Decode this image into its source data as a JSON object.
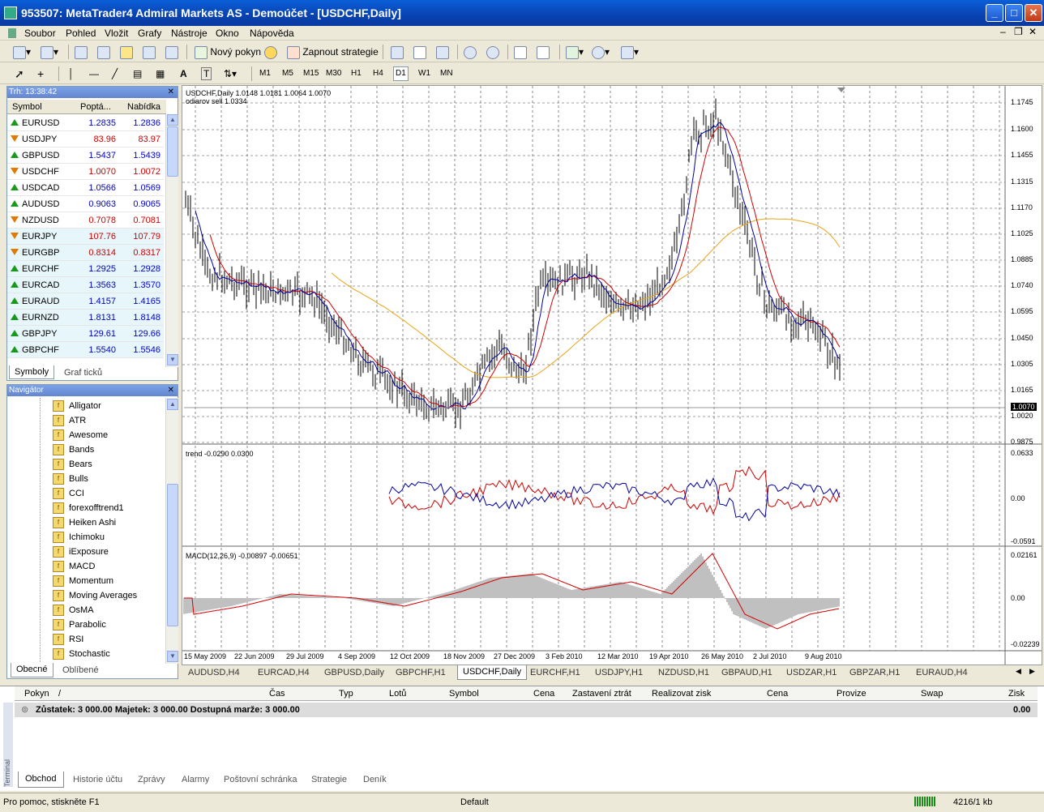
{
  "window": {
    "title": "953507: MetaTrader4 Admiral Markets AS - Demoúčet - [USDCHF,Daily]"
  },
  "menu": [
    "Soubor",
    "Pohled",
    "Vložit",
    "Grafy",
    "Nástroje",
    "Okno",
    "Nápověda"
  ],
  "toolbar": {
    "new_order": "Nový pokyn",
    "start_strategy": "Zapnout strategie"
  },
  "timeframes": [
    "M1",
    "M5",
    "M15",
    "M30",
    "H1",
    "H4",
    "D1",
    "W1",
    "MN"
  ],
  "market_watch": {
    "header": "Trh: 13:38:42",
    "columns": [
      "Symbol",
      "Poptá...",
      "Nabídka"
    ],
    "rows": [
      {
        "symbol": "EURUSD",
        "bid": "1.2835",
        "ask": "1.2836",
        "dir": "up",
        "color": "blue"
      },
      {
        "symbol": "USDJPY",
        "bid": "83.96",
        "ask": "83.97",
        "dir": "down",
        "color": "red"
      },
      {
        "symbol": "GBPUSD",
        "bid": "1.5437",
        "ask": "1.5439",
        "dir": "up",
        "color": "blue"
      },
      {
        "symbol": "USDCHF",
        "bid": "1.0070",
        "ask": "1.0072",
        "dir": "down",
        "color": "red"
      },
      {
        "symbol": "USDCAD",
        "bid": "1.0566",
        "ask": "1.0569",
        "dir": "up",
        "color": "blue"
      },
      {
        "symbol": "AUDUSD",
        "bid": "0.9063",
        "ask": "0.9065",
        "dir": "up",
        "color": "blue"
      },
      {
        "symbol": "NZDUSD",
        "bid": "0.7078",
        "ask": "0.7081",
        "dir": "down",
        "color": "red"
      },
      {
        "symbol": "EURJPY",
        "bid": "107.76",
        "ask": "107.79",
        "dir": "down",
        "color": "red"
      },
      {
        "symbol": "EURGBP",
        "bid": "0.8314",
        "ask": "0.8317",
        "dir": "down",
        "color": "red"
      },
      {
        "symbol": "EURCHF",
        "bid": "1.2925",
        "ask": "1.2928",
        "dir": "up",
        "color": "blue"
      },
      {
        "symbol": "EURCAD",
        "bid": "1.3563",
        "ask": "1.3570",
        "dir": "up",
        "color": "blue"
      },
      {
        "symbol": "EURAUD",
        "bid": "1.4157",
        "ask": "1.4165",
        "dir": "up",
        "color": "blue"
      },
      {
        "symbol": "EURNZD",
        "bid": "1.8131",
        "ask": "1.8148",
        "dir": "up",
        "color": "blue"
      },
      {
        "symbol": "GBPJPY",
        "bid": "129.61",
        "ask": "129.66",
        "dir": "up",
        "color": "blue"
      },
      {
        "symbol": "GBPCHF",
        "bid": "1.5540",
        "ask": "1.5546",
        "dir": "up",
        "color": "blue"
      }
    ],
    "tabs": [
      "Symboly",
      "Graf ticků"
    ]
  },
  "navigator": {
    "header": "Navigátor",
    "items": [
      "Alligator",
      "ATR",
      "Awesome",
      "Bands",
      "Bears",
      "Bulls",
      "CCI",
      "forexofftrend1",
      "Heiken Ashi",
      "Ichimoku",
      "iExposure",
      "MACD",
      "Momentum",
      "Moving Averages",
      "OsMA",
      "Parabolic",
      "RSI",
      "Stochastic"
    ],
    "tabs": [
      "Obecné",
      "Oblíbené"
    ]
  },
  "chart": {
    "info": "USDCHF,Daily  1.0148 1.0181 1.0064 1.0070",
    "info2": "odiarov sell 1.0334",
    "price_labels": [
      "1.1745",
      "1.1600",
      "1.1455",
      "1.1315",
      "1.1170",
      "1.1025",
      "1.0885",
      "1.0740",
      "1.0595",
      "1.0450",
      "1.0305",
      "1.0165",
      "1.0070",
      "1.0020",
      "0.9875"
    ],
    "current_price": "1.0070",
    "trend_label": "trend -0.0290 0.0300",
    "trend_scale": [
      "0.0633",
      "0.00",
      "-0.0591"
    ],
    "macd_label": "MACD(12,26,9) -0.00897 -0.00651",
    "macd_scale": [
      "0.02161",
      "0.00",
      "-0.02239"
    ],
    "dates": [
      "15 May 2009",
      "22 Jun 2009",
      "29 Jul 2009",
      "4 Sep 2009",
      "12 Oct 2009",
      "18 Nov 2009",
      "27 Dec 2009",
      "3 Feb 2010",
      "12 Mar 2010",
      "19 Apr 2010",
      "26 May 2010",
      "2 Jul 2010",
      "9 Aug 2010"
    ]
  },
  "chart_tabs": [
    "AUDUSD,H4",
    "EURCAD,H4",
    "GBPUSD,Daily",
    "GBPCHF,H1",
    "USDCHF,Daily",
    "EURCHF,H1",
    "USDJPY,H1",
    "NZDUSD,H1",
    "GBPAUD,H1",
    "USDZAR,H1",
    "GBPZAR,H1",
    "EURAUD,H4"
  ],
  "terminal": {
    "columns": [
      "Pokyn",
      "/",
      "Čas",
      "Typ",
      "Lotů",
      "Symbol",
      "Cena",
      "Zastavení ztrát",
      "Realizovat zisk",
      "Cena",
      "Provize",
      "Swap",
      "Zisk"
    ],
    "balance_line": "Zůstatek: 3 000.00  Majetek: 3 000.00  Dostupná marže: 3 000.00",
    "balance_profit": "0.00",
    "side_label": "Terminal",
    "tabs": [
      "Obchod",
      "Historie účtu",
      "Zprávy",
      "Alarmy",
      "Poštovní schránka",
      "Strategie",
      "Deník"
    ]
  },
  "status": {
    "help": "Pro pomoc, stiskněte F1",
    "profile": "Default",
    "traffic": "4216/1 kb"
  }
}
